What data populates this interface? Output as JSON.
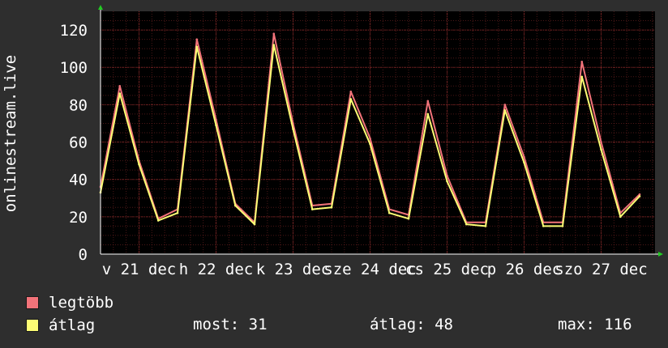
{
  "chart_data": {
    "type": "line",
    "ylabel": "onlinestream.live",
    "ylim": [
      0,
      130
    ],
    "y_ticks": [
      0,
      20,
      40,
      60,
      80,
      100,
      120
    ],
    "x_tick_labels": [
      "v 21 dec",
      "h 22 dec",
      "k 23 dec",
      "sze 24 dec",
      "cs 25 dec",
      "p 26 dec",
      "szo 27 dec"
    ],
    "grid": true,
    "background_color": "#000000",
    "grid_color": "#8b2a2a",
    "series": [
      {
        "name": "legtöbb",
        "color": "#f2737a",
        "x": [
          0.0,
          0.25,
          0.5,
          0.75,
          1.0,
          1.25,
          1.5,
          1.75,
          2.0,
          2.25,
          2.5,
          2.75,
          3.0,
          3.25,
          3.5,
          3.75,
          4.0,
          4.25,
          4.5,
          4.75,
          5.0,
          5.25,
          5.5,
          5.75,
          6.0,
          6.25,
          6.5,
          6.75,
          7.0
        ],
        "values": [
          36,
          90,
          50,
          19,
          24,
          115,
          72,
          27,
          17,
          118,
          70,
          26,
          27,
          87,
          62,
          24,
          21,
          82,
          42,
          17,
          17,
          80,
          52,
          17,
          17,
          103,
          60,
          22,
          32
        ]
      },
      {
        "name": "átlag",
        "color": "#fdfd75",
        "x": [
          0.0,
          0.25,
          0.5,
          0.75,
          1.0,
          1.25,
          1.5,
          1.75,
          2.0,
          2.25,
          2.5,
          2.75,
          3.0,
          3.25,
          3.5,
          3.75,
          4.0,
          4.25,
          4.5,
          4.75,
          5.0,
          5.25,
          5.5,
          5.75,
          6.0,
          6.25,
          6.5,
          6.75,
          7.0
        ],
        "values": [
          33,
          86,
          48,
          18,
          22,
          111,
          69,
          26,
          16,
          112,
          67,
          24,
          25,
          83,
          59,
          22,
          19,
          75,
          39,
          16,
          15,
          77,
          49,
          15,
          15,
          95,
          56,
          20,
          31
        ]
      }
    ]
  },
  "legend": {
    "items": [
      {
        "label": "legtöbb",
        "color": "#f2737a"
      },
      {
        "label": "átlag",
        "color": "#fdfd75"
      }
    ],
    "stats": {
      "now": "most: 31",
      "avg": "átlag: 48",
      "max": "max: 116"
    }
  }
}
